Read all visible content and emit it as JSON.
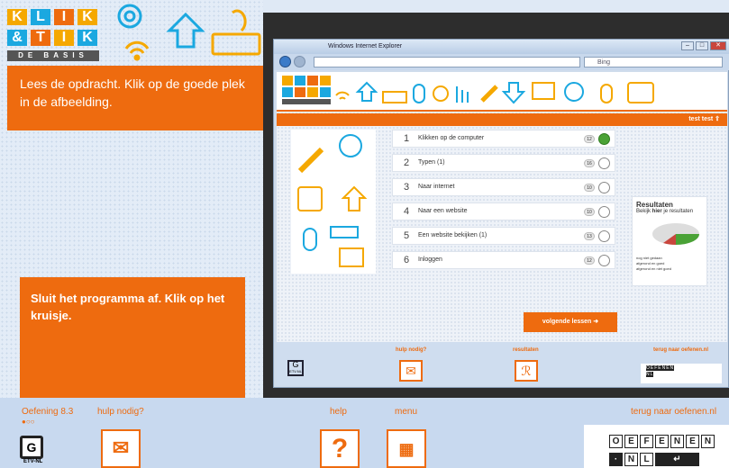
{
  "logo": {
    "row1": [
      "K",
      "L",
      "I",
      "K"
    ],
    "row2": [
      "&",
      "T",
      "I",
      "K"
    ],
    "sub": "DE BASIS"
  },
  "instructions": {
    "task1": "Lees de opdracht. Klik op de goede plek in de afbeelding.",
    "task2": "Sluit het programma af. Klik op het kruisje."
  },
  "browser": {
    "title": "Windows Internet Explorer",
    "search_placeholder": "Bing",
    "user": "test test",
    "lessons": [
      {
        "num": "1",
        "label": "Klikken op de computer",
        "score": "12",
        "done": true
      },
      {
        "num": "2",
        "label": "Typen (1)",
        "score": "16",
        "done": false
      },
      {
        "num": "3",
        "label": "Naar internet",
        "score": "10",
        "done": false
      },
      {
        "num": "4",
        "label": "Naar een website",
        "score": "10",
        "done": false
      },
      {
        "num": "5",
        "label": "Een website bekijken (1)",
        "score": "13",
        "done": false
      },
      {
        "num": "6",
        "label": "Inloggen",
        "score": "12",
        "done": false
      }
    ],
    "results": {
      "title": "Resultaten",
      "text_pre": "Bekijk ",
      "text_bold": "hier",
      "text_post": " je resultaten",
      "legend": [
        "nog niet gedaan",
        "afgerond en goed",
        "afgerond en niet goed"
      ]
    },
    "next_label": "volgende lessen",
    "footer": {
      "help": "hulp nodig?",
      "results": "resultaten",
      "back": "terug naar oefenen.nl",
      "etv": "ETV.NL"
    }
  },
  "bottom": {
    "exercise": "Oefening 8.3",
    "help_needed": "hulp nodig?",
    "help": "help",
    "menu": "menu",
    "back": "terug naar oefenen.nl",
    "etv": "ETV-NL",
    "oefenen_row1": [
      "O",
      "E",
      "F",
      "E",
      "N",
      "E",
      "N"
    ],
    "oefenen_row2": [
      "N",
      "L"
    ]
  },
  "colors": {
    "accent": "#ee6b0f",
    "background": "#dfe9f5",
    "done": "#4aa236"
  }
}
